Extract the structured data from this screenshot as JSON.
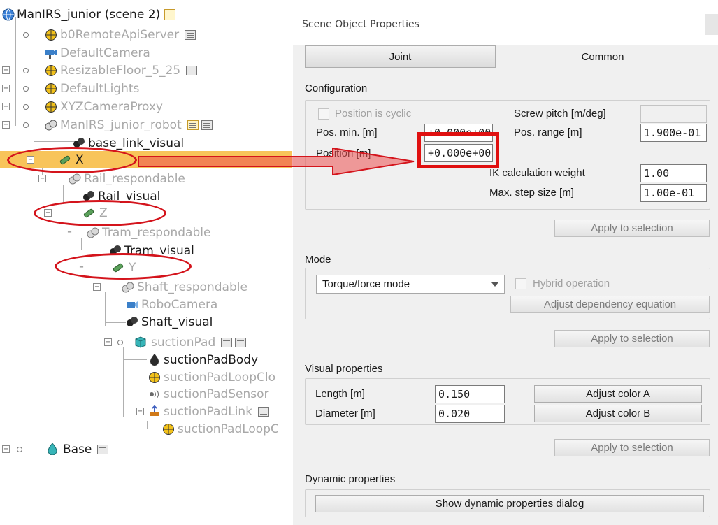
{
  "tree": {
    "items": [
      {
        "label": "ManIRS_junior (scene 2)",
        "style": "norm"
      },
      {
        "label": "b0RemoteApiServer",
        "style": "dim"
      },
      {
        "label": "DefaultCamera",
        "style": "dim"
      },
      {
        "label": "ResizableFloor_5_25",
        "style": "dim"
      },
      {
        "label": "DefaultLights",
        "style": "dim"
      },
      {
        "label": "XYZCameraProxy",
        "style": "dim"
      },
      {
        "label": "ManIRS_junior_robot",
        "style": "dim"
      },
      {
        "label": "base_link_visual",
        "style": "norm"
      },
      {
        "label": "X",
        "style": "norm"
      },
      {
        "label": "Rail_respondable",
        "style": "dim"
      },
      {
        "label": "Rail_visual",
        "style": "norm"
      },
      {
        "label": "Z",
        "style": "dim"
      },
      {
        "label": "Tram_respondable",
        "style": "dim"
      },
      {
        "label": "Tram_visual",
        "style": "norm"
      },
      {
        "label": "Y",
        "style": "dim"
      },
      {
        "label": "Shaft_respondable",
        "style": "dim"
      },
      {
        "label": "RoboCamera",
        "style": "dim"
      },
      {
        "label": "Shaft_visual",
        "style": "norm"
      },
      {
        "label": "suctionPad",
        "style": "dim"
      },
      {
        "label": "suctionPadBody",
        "style": "norm"
      },
      {
        "label": "suctionPadLoopClo",
        "style": "dim"
      },
      {
        "label": "suctionPadSensor",
        "style": "dim"
      },
      {
        "label": "suctionPadLink",
        "style": "dim"
      },
      {
        "label": "suctionPadLoopC",
        "style": "dim"
      },
      {
        "label": "Base",
        "style": "norm"
      }
    ],
    "selected_index": 8
  },
  "dialog": {
    "title": "Scene Object Properties",
    "tabs": {
      "joint": "Joint",
      "common": "Common"
    },
    "configuration": {
      "header": "Configuration",
      "position_cyclic_label": "Position is cyclic",
      "screw_pitch_label": "Screw pitch [m/deg]",
      "screw_pitch_value": "",
      "pos_min_label": "Pos. min. [m]",
      "pos_min_value": "+0.000e+00",
      "pos_range_label": "Pos. range [m]",
      "pos_range_value": "1.900e-01",
      "position_label": "Position [m]",
      "position_value": "+0.000e+00",
      "ik_weight_label": "IK calculation weight",
      "ik_weight_value": "1.00",
      "max_step_label": "Max. step size [m]",
      "max_step_value": "1.00e-01",
      "apply_label": "Apply to selection"
    },
    "mode": {
      "header": "Mode",
      "selected": "Torque/force mode",
      "hybrid_label": "Hybrid operation",
      "adjust_dependency_label": "Adjust dependency equation",
      "apply_label": "Apply to selection"
    },
    "visual": {
      "header": "Visual properties",
      "length_label": "Length [m]",
      "length_value": "0.150",
      "diameter_label": "Diameter [m]",
      "diameter_value": "0.020",
      "color_a_label": "Adjust color A",
      "color_b_label": "Adjust color B",
      "apply_label": "Apply to selection"
    },
    "dynamic": {
      "header": "Dynamic properties",
      "show_dialog_label": "Show dynamic properties dialog"
    }
  },
  "colors": {
    "selection": "#f8c45a",
    "annotation_red": "#d4141c",
    "dim_text": "#a8a8a8"
  }
}
